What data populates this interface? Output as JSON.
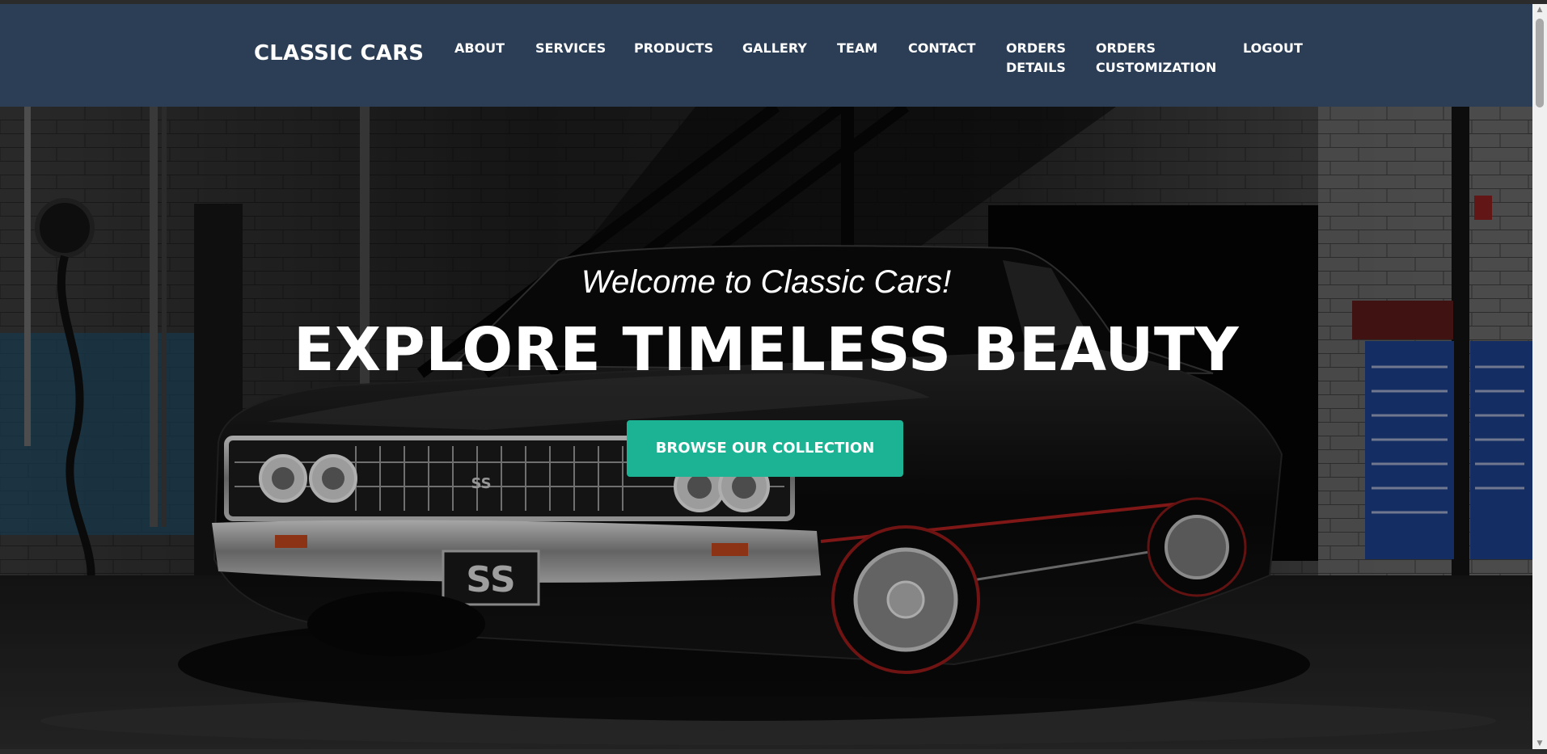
{
  "navbar": {
    "brand": "CLASSIC CARS",
    "items": [
      {
        "lines": [
          "ABOUT"
        ]
      },
      {
        "lines": [
          "SERVICES"
        ]
      },
      {
        "lines": [
          "PRODUCTS"
        ]
      },
      {
        "lines": [
          "GALLERY"
        ]
      },
      {
        "lines": [
          "TEAM"
        ]
      },
      {
        "lines": [
          "CONTACT"
        ]
      },
      {
        "lines": [
          "ORDERS",
          "DETAILS"
        ]
      },
      {
        "lines": [
          "ORDERS",
          "CUSTOMIZATION"
        ]
      },
      {
        "lines": [
          "LOGOUT"
        ]
      }
    ]
  },
  "hero": {
    "welcome": "Welcome to Classic Cars!",
    "headline": "EXPLORE TIMELESS BEAUTY",
    "cta_label": "BROWSE OUR COLLECTION",
    "plate_text": "SS",
    "grille_badge": "SS"
  },
  "colors": {
    "navbar_bg": "#2c3e55",
    "cta_bg": "#1bb394",
    "text": "#ffffff"
  }
}
